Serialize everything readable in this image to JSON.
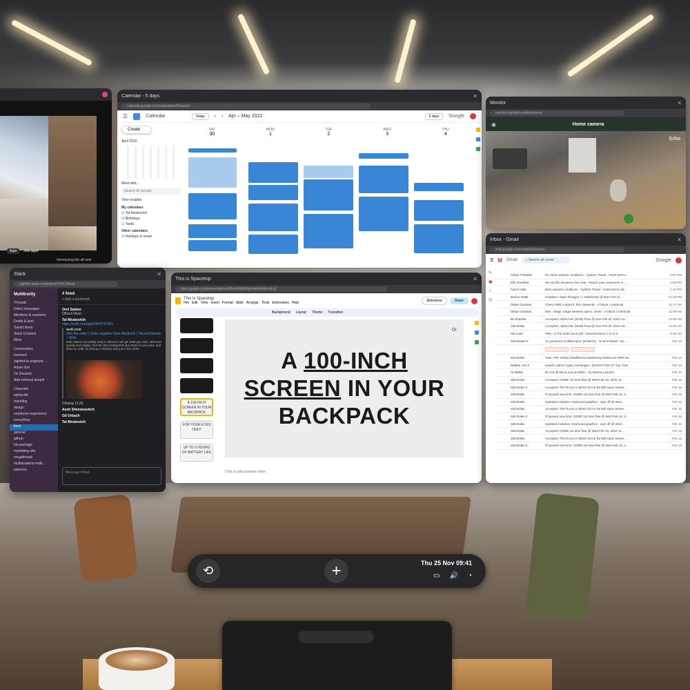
{
  "calendar": {
    "tab": "Calendar - 5 days",
    "url": "calendar.google.com/calendar/u/0/r/week",
    "app": "Calendar",
    "today": "Today",
    "range": "Apr – May 2022",
    "view": "5 days",
    "brand": "Google",
    "create": "Create",
    "mini_month": "April 2022",
    "meet": "Meet with…",
    "search_people": "Search for people",
    "time_insights": "Time insights",
    "my_calendars": "My calendars",
    "cal_items": [
      "Tal Moskovich",
      "Birthdays",
      "Tasks"
    ],
    "other_calendars": "Other calendars",
    "holidays": "Holidays in Israel",
    "days": [
      {
        "dow": "SAT",
        "num": "30"
      },
      {
        "dow": "MON",
        "num": "1"
      },
      {
        "dow": "TUE",
        "num": "2"
      },
      {
        "dow": "WED",
        "num": "3"
      },
      {
        "dow": "THU",
        "num": "4"
      }
    ]
  },
  "camera": {
    "tab": "Monitor",
    "url": "monitor.sighthd.com/live/home",
    "title": "Home camera",
    "overlay": "Grbo"
  },
  "slides": {
    "tab": "This is Spacetop",
    "url": "docs.google.com/presentation/d/1bx4Mp8Aqyl/edit#slide=id.g1",
    "doc_title": "This is Spacetop",
    "menus": [
      "File",
      "Edit",
      "View",
      "Insert",
      "Format",
      "Slide",
      "Arrange",
      "Tools",
      "Extensions",
      "Help"
    ],
    "toolbar": [
      "Background",
      "Layout",
      "Theme",
      "Transition"
    ],
    "slideshow": "Slideshow",
    "share": "Share",
    "line1_pre": "A ",
    "line1_u": "100-INCH",
    "line2_u": "SCREEN",
    "line2_post": " IN YOUR",
    "line3": "BACKPACK",
    "thumbs": [
      "A 100-INCH SCREEN IN YOUR BACKPACK",
      "FOR YOUR EYES ONLY",
      "UP TO 5 HOURS OF BATTERY LIFE"
    ],
    "speaker_notes": "Click to add speaker notes"
  },
  "gmail": {
    "tab": "Inbox - Gmail",
    "url": "mail.google.com/mail/u/0/#inbox",
    "app": "Gmail",
    "search": "Search all conve",
    "brand": "Google",
    "rows": [
      {
        "s": "Ashes Trimarks",
        "b": "Re: Best network conditions - System Travel - Insert test to…",
        "d": "2:57 PM"
      },
      {
        "s": "Elio Grunfeld",
        "b": "Set up Elio Browsers live chat - Reach your customers in…",
        "d": "2:50 PM"
      },
      {
        "s": "Aaron Hale",
        "b": "Best network conditions - System Travel - Insert test to all…",
        "d": "1:42 PM"
      },
      {
        "s": "Burton Yeats",
        "b": "Invitation: Sapir Shragan <> Multitrority @ Mon Feb 21…",
        "d": "12:18 PM"
      },
      {
        "s": "Oksar Gusman",
        "b": "Chess Math a launch: this rdawenta - 4 Oksar | notebook",
        "d": "11:47 AM"
      },
      {
        "s": "Oksar Gusman",
        "b": "Msn - Magic Stage wireless specs: mesh - 4 Oksar | notebook",
        "d": "11:08 AM"
      },
      {
        "s": "Eli Shackel",
        "b": "Accepted: Alpha Sim (SOB) Flow @ Sun Feb 20, 2022 13:…",
        "d": "10:56 AM"
      },
      {
        "s": "Sirit Dolev",
        "b": "Accepted: Alpha Sim (SOB) Flow @ Sun Feb 20, 2022 03:…",
        "d": "10:26 AM"
      },
      {
        "s": "Gili Lusa",
        "b": "Plan - In the math issue pdf - resolved twice 2 or to tc",
        "d": "9:48 AM"
      },
      {
        "s": "Sirit Daniel 2",
        "b": "Co-presence Collaboration [SOMAN] - Hi Sirit Daniel, I've…",
        "d": "Feb 15"
      },
      {
        "s": "",
        "b": "",
        "d": ""
      },
      {
        "s": "Sirit Dolev",
        "b": "Todo: FW: Infinity Mindfulness Multitrority Radiocom DRR Do…",
        "d": "Feb 15"
      },
      {
        "s": "Debbie, me 3",
        "b": "Israel's safest crypto exchanges - INVESTTOR ST Tue, Feb…",
        "d": "Feb 15"
      },
      {
        "s": "Ar Mahle",
        "b": "Do not all about your portfolio - by Marina Latruhin",
        "d": "Feb 15"
      },
      {
        "s": "Sirit Dolev",
        "b": "Accepted: OOBE 1st time flow @ Wed Feb 16, 2022 12…",
        "d": "Feb 15"
      },
      {
        "s": "Sirit Dolev 2",
        "b": "Accepted: The Room in Which Dol & Tal Will Have Seven…",
        "d": "Feb 15"
      },
      {
        "s": "Sirit Dolev",
        "b": "Proposed new time: OOBE 1st time flow @ Wed Feb 16, 2…",
        "d": "Feb 15"
      },
      {
        "s": "Sirit Dolev",
        "b": "Updated invitation: Keyboard graphics - sign off @ Wed…",
        "d": "Feb 15"
      },
      {
        "s": "Sirit Dolev",
        "b": "Accepted: The Room in Which Dol & Tal Will Have Seven…",
        "d": "Feb 15"
      },
      {
        "s": "Sirit Dolev 2",
        "b": "Proposed new time: OOBE 1st time flow @ Wed Feb 16, 2…",
        "d": "Feb 15"
      },
      {
        "s": "Sirit Dolev",
        "b": "Updated invitation: Keyboard graphics - sign off @ Wed…",
        "d": "Feb 15"
      },
      {
        "s": "Sirit Dolev",
        "b": "Accepted: OOBE 1st time flow @ Wed Feb 16, 2022 12…",
        "d": "Feb 15"
      },
      {
        "s": "Sirit Dolev",
        "b": "Accepted: The Room in Which Dol & Tal Will Have Seven…",
        "d": "Feb 15"
      },
      {
        "s": "Sirit Dolev 2",
        "b": "Proposed new time: OOBE 1st time flow @ Wed Feb 16, 2…",
        "d": "Feb 15"
      }
    ]
  },
  "slack": {
    "tab": "Slack",
    "url": "sighthd.slack.com/client/T02/C0food",
    "workspace": "Multitrority",
    "channel": "# food",
    "add_bookmark": "+ Add a bookmark",
    "side_top": [
      "Threads",
      "Direct messages",
      "Mentions & reactions",
      "Drafts & sent",
      "Saved items",
      "Slack Connect",
      "More"
    ],
    "connections": "Connections",
    "side_dms": [
      "Involved",
      "sighthd-to-engineer…",
      "Adam Gini",
      "Oz Deutsch",
      "Add external people"
    ],
    "channels": "Channels",
    "side_channels": [
      "alpha-dbt",
      "branding",
      "design",
      "employee-experience",
      "everything",
      "food",
      "general",
      "github",
      "hw-package",
      "marketing-site",
      "megathread",
      "multiacademy-halli…",
      "planners",
      "product-designer"
    ],
    "selected": "food",
    "msg1_name": "Orel Sadeer",
    "msg1_text": "Ofiza Foliver",
    "msg2_name": "Tal Moskovich",
    "msg2_link": "https://wolt.com/app/GR4T4Y3DL",
    "wolt": "wolt.com",
    "wolt_title": "Join the order | Order together from Mordechi | Tal and friends – Wolt",
    "wolt_desc": "Wolt makes it incredibly easy to discover and get what you want, delivered quickly and reliably. Find the best restaurants and stores in your area, and place an order for pickup or delivery with just a few clicks.",
    "closing": "Closing 12:23",
    "msg3_name": "Aesh Shimonovitch",
    "msg4_name": "Gil Orbach",
    "msg5_name": "Tal Moskovich",
    "composer": "Message #food"
  },
  "leftwin": {
    "action1": "Auto",
    "action2": "Join apps",
    "caption": "Introducing the all-new"
  },
  "dock": {
    "time": "Thu 25 Nov  09:41",
    "plus": "+"
  }
}
